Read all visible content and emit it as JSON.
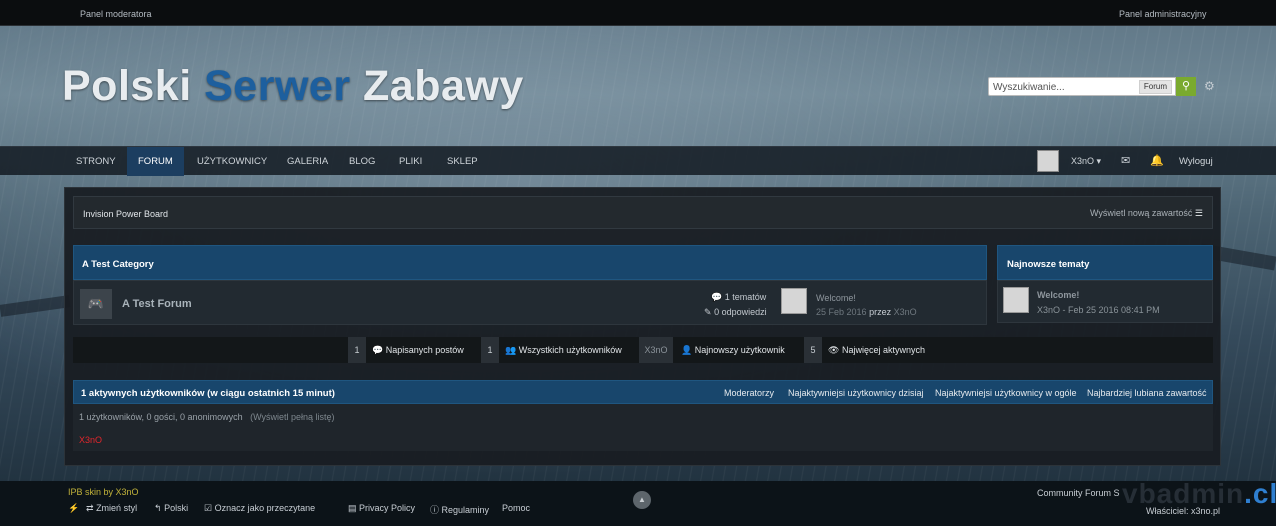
{
  "topbar": {
    "left_link": "Panel moderatora",
    "right_link": "Panel administracyjny"
  },
  "header": {
    "logo_part1": "Polski",
    "logo_part2": "Serwer",
    "logo_part3": "Zabawy",
    "search_placeholder": "Wyszukiwanie...",
    "search_scope": "Forum"
  },
  "nav": {
    "items": [
      "STRONY",
      "FORUM",
      "UŻYTKOWNICY",
      "GALERIA",
      "BLOG",
      "PLIKI",
      "SKLEP"
    ],
    "active": "FORUM",
    "username": "X3nO",
    "logout": "Wyloguj"
  },
  "breadcrumb": {
    "title": "Invision Power Board",
    "new_content": "Wyświetl nową zawartość"
  },
  "category": {
    "title": "A Test Category",
    "forum": {
      "name": "A Test Forum",
      "topics": "1 tematów",
      "replies": "0 odpowiedzi",
      "last_title": "Welcome!",
      "last_date": "25 Feb 2016",
      "last_by_word": "przez",
      "last_author": "X3nO"
    }
  },
  "latest_topics": {
    "title": "Najnowsze tematy",
    "items": [
      {
        "title": "Welcome!",
        "meta": "X3nO - Feb 25 2016 08:41 PM"
      }
    ]
  },
  "stats": {
    "posts_count": "1",
    "posts_label": "Napisanych postów",
    "users_count": "1",
    "users_label": "Wszystkich użytkowników",
    "newest_user": "X3nO",
    "newest_label": "Najnowszy użytkownik",
    "most_active_count": "5",
    "most_active_label": "Najwięcej aktywnych"
  },
  "online": {
    "title": "1 aktywnych użytkowników (w ciągu ostatnich 15 minut)",
    "links": [
      "Moderatorzy",
      "Najaktywniejsi użytkownicy dzisiaj",
      "Najaktywniejsi użytkownicy w ogóle",
      "Najbardziej lubiana zawartość"
    ],
    "counts": "1 użytkowników, 0 gości, 0 anonimowych",
    "full_list": "(Wyświetl pełną listę)",
    "user": "X3nO"
  },
  "footer": {
    "skin": "IPB skin by X3nO",
    "change_style": "Zmień styl",
    "language": "Polski",
    "mark_read": "Oznacz jako przeczytane",
    "privacy": "Privacy Policy",
    "rules": "Regulaminy",
    "help": "Pomoc",
    "copyright": "Community Forum S",
    "owner": "Właściciel: x3no.pl"
  },
  "watermark": {
    "text": "vbadmin",
    "club": ".club"
  },
  "colors": {
    "accent": "#18466c",
    "active_nav": "#1c3e60",
    "search_button": "#7aaa2e",
    "online_user": "#e2262c"
  }
}
